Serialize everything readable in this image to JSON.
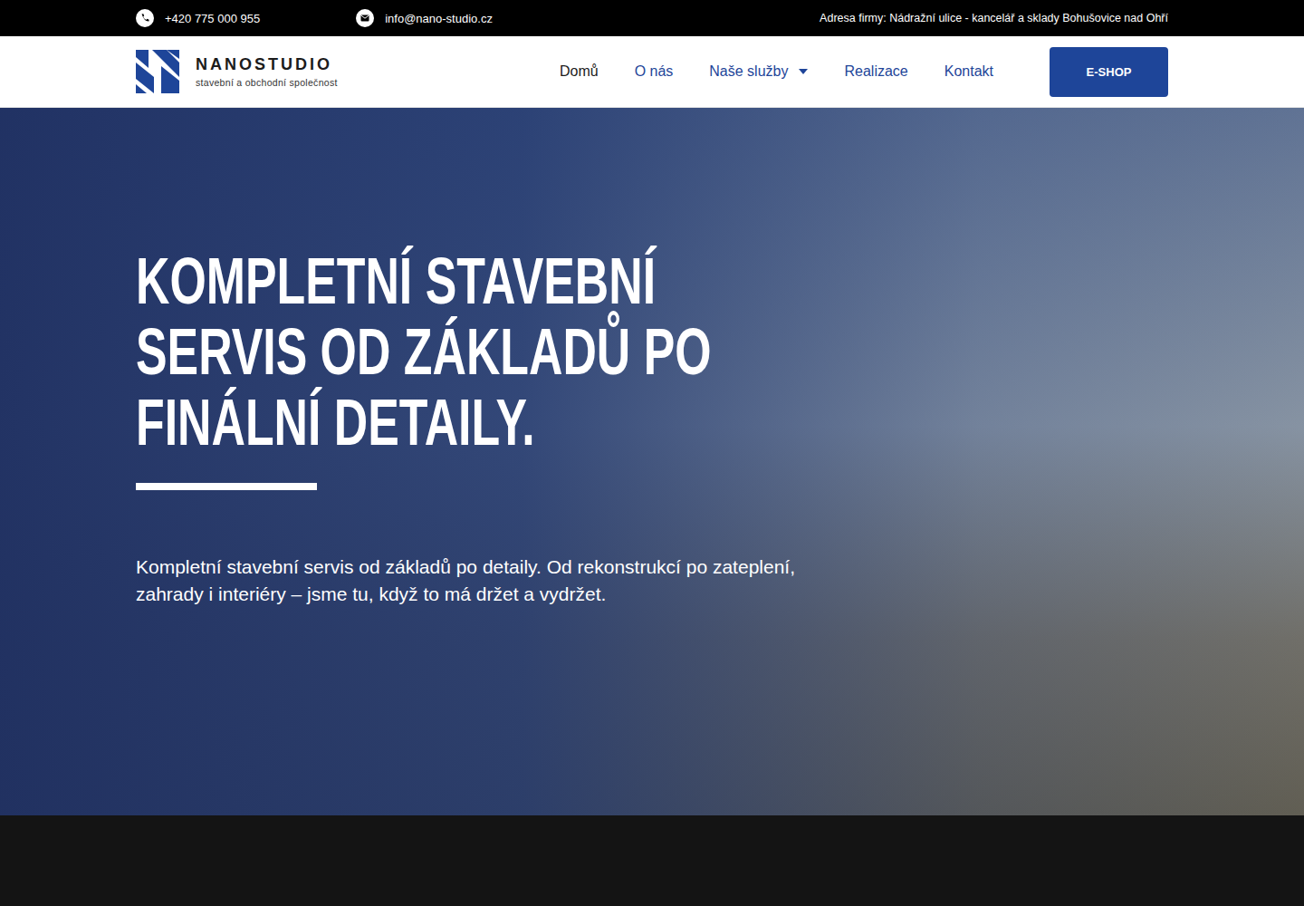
{
  "top_bar": {
    "phone": "+420 775 000 955",
    "email": "info@nano-studio.cz",
    "address": "Adresa firmy: Nádražní ulice - kancelář a sklady Bohušovice nad Ohří"
  },
  "logo": {
    "name": "NANOSTUDIO",
    "tagline": "stavební a obchodní společnost"
  },
  "nav": [
    {
      "label": "Domů",
      "selected": true,
      "has_menu": false
    },
    {
      "label": "O nás",
      "selected": false,
      "has_menu": false
    },
    {
      "label": "Naše služby",
      "selected": false,
      "has_menu": true
    },
    {
      "label": "Realizace",
      "selected": false,
      "has_menu": false
    },
    {
      "label": "Kontakt",
      "selected": false,
      "has_menu": false
    }
  ],
  "eshop_button": "E-SHOP",
  "hero": {
    "title": "KOMPLETNÍ STAVEBNÍ SERVIS OD ZÁKLADŮ PO FINÁLNÍ DETAILY.",
    "text": "Kompletní stavební servis od základů po detaily. Od rekonstrukcí po zateplení, zahrady i interiéry – jsme tu, když to má držet a vydržet."
  }
}
